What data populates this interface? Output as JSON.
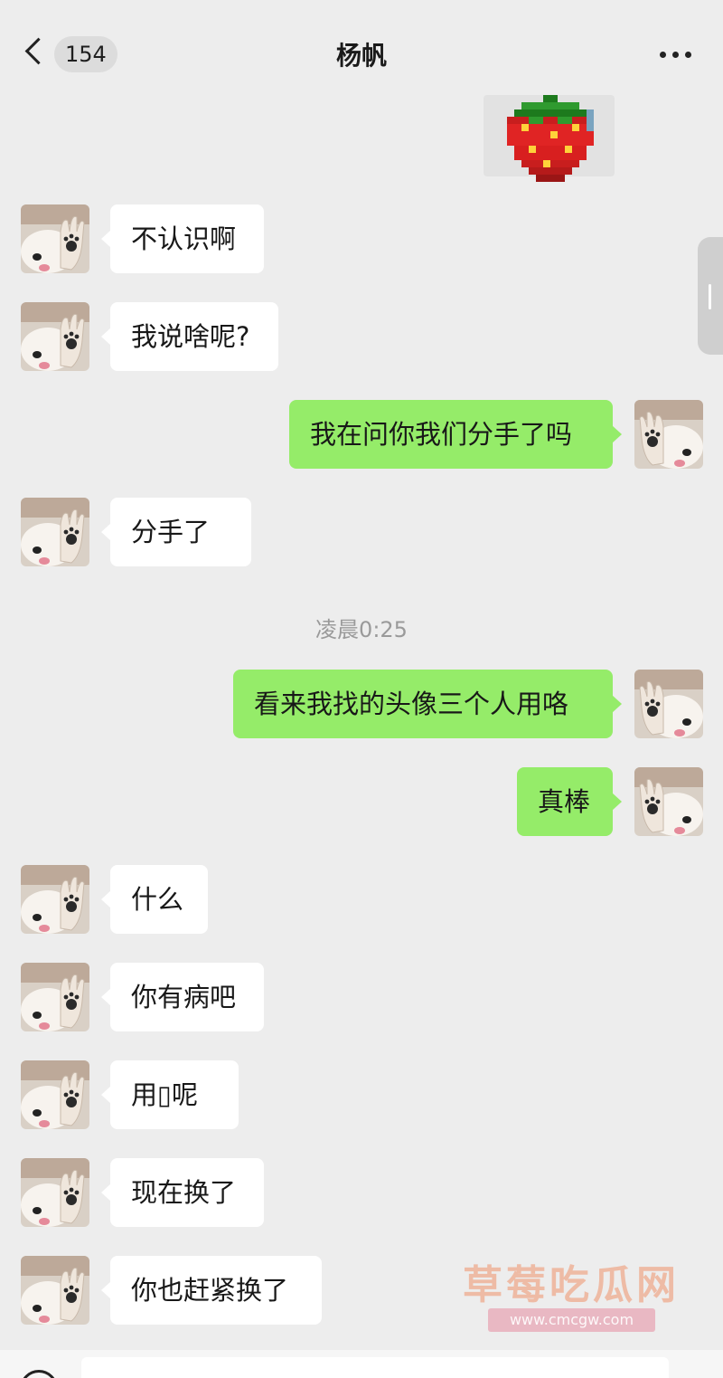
{
  "header": {
    "unread_count": "154",
    "title": "杨帆"
  },
  "sticker": {
    "description_icon": "strawberry-pixel-sticker"
  },
  "messages": [
    {
      "side": "in",
      "text": "不认识啊"
    },
    {
      "side": "in",
      "text": "我说啥呢?"
    },
    {
      "side": "out",
      "text": "我在问你我们分手了吗"
    },
    {
      "side": "in",
      "text": " 分手了"
    },
    {
      "side": "out",
      "text": "看来我找的头像三个人用咯"
    },
    {
      "side": "out",
      "text": "真棒"
    },
    {
      "side": "in",
      "text": "什么"
    },
    {
      "side": "in",
      "text": "你有病吧"
    },
    {
      "side": "in",
      "text": "用▯呢"
    },
    {
      "side": "in",
      "text": "现在换了"
    },
    {
      "side": "in",
      "text": "你也赶紧换了"
    }
  ],
  "timestamp": "凌晨0:25",
  "watermark": {
    "text": "草莓吃瓜网",
    "url": "www.cmcgw.com"
  },
  "colors": {
    "background": "#ededed",
    "incoming_bubble": "#ffffff",
    "outgoing_bubble": "#95ec69"
  },
  "icons": {
    "back": "chevron-left-icon",
    "more": "more-dots-icon",
    "voice": "voice-icon"
  }
}
